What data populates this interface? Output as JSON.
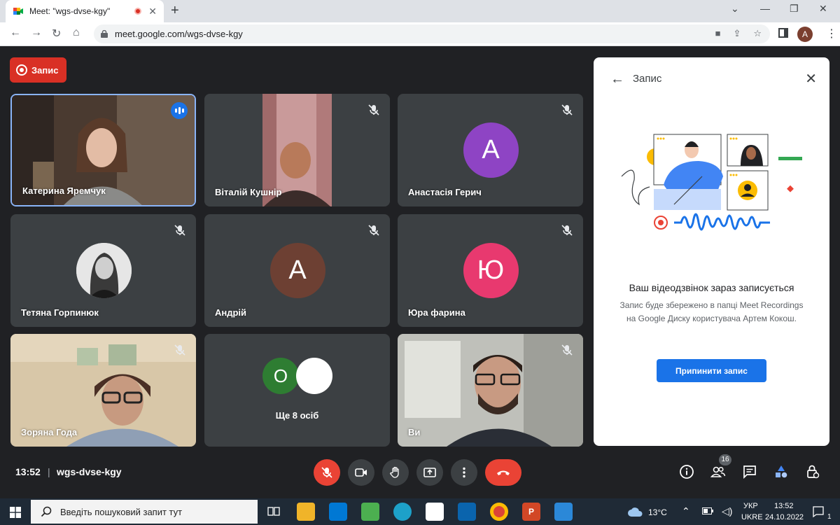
{
  "browser": {
    "tab_title": "Meet: \"wgs-dvse-kgy\"",
    "url": "meet.google.com/wgs-dvse-kgy",
    "profile_initial": "A"
  },
  "meet": {
    "recording_label": "Запис",
    "participants": [
      {
        "name": "Катерина Яремчук",
        "speaking": true
      },
      {
        "name": "Віталій Кушнір"
      },
      {
        "name": "Анастасія Герич",
        "avatar_letter": "А",
        "avatar_color": "#8e44c4"
      },
      {
        "name": "Тетяна Горпинюк"
      },
      {
        "name": "Андрій",
        "avatar_letter": "А",
        "avatar_color": "#6d4033"
      },
      {
        "name": "Юра фарина",
        "avatar_letter": "Ю",
        "avatar_color": "#e8396f"
      },
      {
        "name": "Зоряна Года"
      },
      {
        "more_label": "Ще 8 осіб",
        "avatar_letter": "О",
        "avatar_color": "#2e7d32"
      },
      {
        "name": "Ви"
      }
    ],
    "clock": "13:52",
    "separator": "|",
    "meeting_code": "wgs-dvse-kgy",
    "people_count": "16"
  },
  "panel": {
    "title": "Запис",
    "heading": "Ваш відеодзвінок зараз записується",
    "text": "Запис буде збережено в папці Meet Recordings на Google Диску користувача Артем Кокош.",
    "stop_button": "Припинити запис"
  },
  "taskbar": {
    "search_placeholder": "Введіть пошуковий запит тут",
    "temperature": "13°C",
    "lang_line1": "УКР",
    "lang_line2": "UKRE",
    "time": "13:52",
    "date": "24.10.2022",
    "notification_count": "1"
  },
  "colors": {
    "meet_bg": "#202124",
    "tile_bg": "#3c4043",
    "recording_red": "#d93025",
    "accent_blue": "#1a73e8"
  }
}
